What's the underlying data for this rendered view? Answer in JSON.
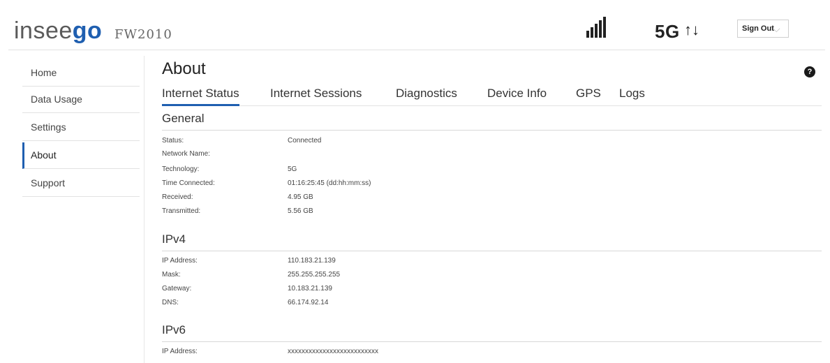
{
  "header": {
    "brand_prefix": "insee",
    "brand_suffix": "go",
    "model": "FW2010",
    "network_type": "5G",
    "transfer_arrows": "↑↓",
    "signout_label": "Sign Out",
    "signout_chevron": "⌵",
    "signal_bars_filled": 5,
    "signal_bars_total": 5
  },
  "sidebar": {
    "items": [
      {
        "label": "Home"
      },
      {
        "label": "Data Usage"
      },
      {
        "label": "Settings"
      },
      {
        "label": "About"
      },
      {
        "label": "Support"
      }
    ],
    "active": "About"
  },
  "main": {
    "title": "About",
    "help_glyph": "?",
    "tabs": [
      {
        "label": "Internet Status"
      },
      {
        "label": "Internet Sessions"
      },
      {
        "label": "Diagnostics"
      },
      {
        "label": "Device Info"
      },
      {
        "label": "GPS"
      },
      {
        "label": "Logs"
      }
    ],
    "active_tab": "Internet Status",
    "general": {
      "title": "General",
      "rows": [
        {
          "label": "Status:",
          "value": "Connected"
        },
        {
          "label": "Network Name:",
          "value": ""
        },
        {
          "label": "Technology:",
          "value": "5G"
        },
        {
          "label": "Time Connected:",
          "value": "01:16:25:45 (dd:hh:mm:ss)"
        },
        {
          "label": "Received:",
          "value": "4.95 GB"
        },
        {
          "label": "Transmitted:",
          "value": "5.56 GB"
        }
      ]
    },
    "ipv4": {
      "title": "IPv4",
      "rows": [
        {
          "label": "IP Address:",
          "value": "110.183.21.139"
        },
        {
          "label": "Mask:",
          "value": "255.255.255.255"
        },
        {
          "label": "Gateway:",
          "value": "10.183.21.139"
        },
        {
          "label": "DNS:",
          "value": "66.174.92.14"
        }
      ]
    },
    "ipv6": {
      "title": "IPv6",
      "rows": [
        {
          "label": "IP Address:",
          "value": "xxxxxxxxxxxxxxxxxxxxxxxxxx"
        }
      ]
    }
  },
  "colors": {
    "accent": "#1f5fb0",
    "text": "#222222",
    "rule": "#d8d8d8"
  }
}
